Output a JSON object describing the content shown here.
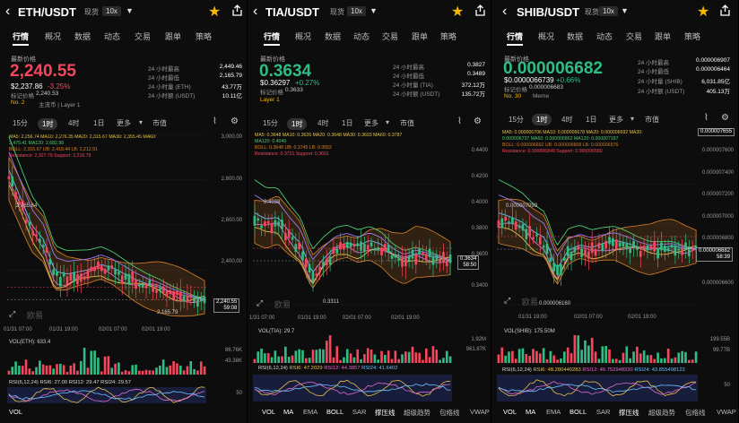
{
  "colors": {
    "up": "#2fbd85",
    "down": "#f6465d",
    "ma5": "#e7c24a",
    "ma10": "#e26bd2",
    "ma20": "#6ac0ff",
    "ma30": "#9b7cf2",
    "ma60": "#f6465d",
    "ma120": "#4ecb73",
    "boll": "#d9822b",
    "accent": "#f5b800"
  },
  "common": {
    "back_icon": "chevron-left-icon",
    "tag": "现货",
    "leverage": "10x",
    "tabs": [
      "行情",
      "概况",
      "数据",
      "动态",
      "交易",
      "跟单",
      "策略"
    ],
    "latest_label": "最新价格",
    "mark_label": "标记价格",
    "stat_labels": [
      "24 小时最高",
      "24 小时最低"
    ],
    "timeframes": [
      "15分",
      "1时",
      "4时",
      "1日"
    ],
    "more": "更多",
    "depth": "市值",
    "watermark": "欧易",
    "bottom": [
      "VOL",
      "MA",
      "EMA",
      "BOLL",
      "SAR",
      "撑压线",
      "超级趋势",
      "包络线",
      "VWAP"
    ]
  },
  "panels": [
    {
      "pair": "ETH/USDT",
      "price": "2,240.55",
      "price_color": "down",
      "usd": "$2,237.86",
      "change": "-3.25%",
      "mark": "2,240.53",
      "rank": "No. 2",
      "tags": "主流币 | Layer 1",
      "stats": [
        [
          "24 小时最高",
          "2,449.46"
        ],
        [
          "24 小时最低",
          "2,165.79"
        ],
        [
          "24 小时量 (ETH)",
          "43.77万"
        ],
        [
          "24 小时额 (USDT)",
          "10.11亿"
        ]
      ],
      "ind1": "MA5: 2,256.74  MA10: 2,276.35  MA20: 2,315.67  MA30: 2,355.45  MA60:",
      "ind2": "2,479.41  MA120: 2,682.96",
      "ind3": "BOLL: 2,315.67  UB: 2,418.44  LB: 2,212.91",
      "ind4": "Resistance: 2,327.79  Support: 2,216.79",
      "axis": [
        "3,000.00",
        "2,800.00",
        "2,600.00",
        "2,400.00",
        "2,200.00"
      ],
      "hi_label": "2,765.64",
      "lo_label": "2,165.79",
      "last": "2,240.55",
      "timer": "59:08",
      "dates": [
        "01/31 07:00",
        "01/31 19:00",
        "02/01 07:00",
        "02/01 19:00"
      ],
      "vol_label": "VOL(ETH): 633.4",
      "vol_axis": [
        "86.76K",
        "43.38K"
      ],
      "rsi": "RSI(6,12,24)  RSI6: 27.00  RSI12: 29.47  RSI24: 29.57",
      "rsi_axis": "50",
      "chart_data": {
        "type": "candlestick",
        "title": "",
        "ylim": [
          2100,
          3050
        ],
        "ticks": [
          3000,
          2800,
          2600,
          2400,
          2200
        ],
        "high": 2765.64,
        "low": 2165.79,
        "last": 2240.55
      }
    },
    {
      "pair": "TIA/USDT",
      "price": "0.3634",
      "price_color": "up",
      "usd": "$0.36297",
      "change": "+0.27%",
      "mark": "0.3633",
      "rank": "",
      "tags": "Layer 1",
      "stats": [
        [
          "24 小时最高",
          "0.3827"
        ],
        [
          "24 小时最低",
          "0.3489"
        ],
        [
          "24 小时量 (TIA)",
          "372.12万"
        ],
        [
          "24 小时额 (USDT)",
          "135.72万"
        ]
      ],
      "ind1": "MA5: 0.3648  MA10: 0.3626  MA20: 0.3648  MA30: 0.3693  MA60: 0.3787",
      "ind2": "MA120: 0.4049",
      "ind3": "BOLL: 0.3648  UB: 0.3745  LB: 0.3552",
      "ind4": "Resistance: 0.3721  Support: 0.3601",
      "axis": [
        "0.4400",
        "0.4200",
        "0.4000",
        "0.3800",
        "0.3600",
        "0.3400"
      ],
      "hi_label": "0.4038",
      "lo_label": "0.3311",
      "last": "0.3634",
      "timer": "58:50",
      "dates": [
        "1/31 07:00",
        "01/31 19:00",
        "02/01 07:00",
        "02/01 19:00"
      ],
      "vol_label": "VOL(TIA): 29.7",
      "vol_axis": [
        "1.92M",
        "961.87K"
      ],
      "rsi": "RSI(6,12,24)  RSI6: 47.2029  RSI12: 44.3857  RSI24: 41.6402",
      "rsi_axis": "",
      "chart_data": {
        "type": "candlestick",
        "title": "",
        "ylim": [
          0.325,
          0.45
        ],
        "ticks": [
          0.44,
          0.42,
          0.4,
          0.38,
          0.36,
          0.34
        ],
        "high": 0.4038,
        "low": 0.3311,
        "last": 0.3634
      }
    },
    {
      "pair": "SHIB/USDT",
      "price": "0.000006682",
      "price_color": "up",
      "usd": "$0.0000066739",
      "change": "+0.66%",
      "mark": "0.000006683",
      "rank": "No. 30",
      "tags": "Meme",
      "stats": [
        [
          "24 小时最高",
          "0.000006907"
        ],
        [
          "24 小时最低",
          "0.000006464"
        ],
        [
          "24 小时量 (SHIB)",
          "6,031.85亿"
        ],
        [
          "24 小时额 (USDT)",
          "405.13万"
        ]
      ],
      "ind1": "MA5: 0.000006706  MA10: 0.000006678  MA20: 0.000006692  MA30:",
      "ind2": "0.000006737  MA60: 0.000006863  MA120: 0.000007187",
      "ind3": "BOLL: 0.000006692  UB: 0.000006808  LB: 0.000006576",
      "ind4": "Resistance: 0.000006840  Support: 0.000006580",
      "axis": [
        "0.000007600",
        "0.000007400",
        "0.000007200",
        "0.000007000",
        "0.000006800",
        "0.000006600"
      ],
      "top_box": "0.000007655",
      "hi_label": "0.000007099",
      "lo_label": "0.000006160",
      "last": "0.000006682",
      "timer": "58:39",
      "dates": [
        "01/31 19:00",
        "02/01 07:00",
        "02/01 19:00"
      ],
      "vol_label": "VOL(SHIB): 175.50M",
      "vol_axis": [
        "199.55B",
        "99.77B"
      ],
      "rsi": "RSI(6,12,24)  RSI6: 48.280440283  RSI12: 46.752948330  RSI24: 43.855498123",
      "rsi_axis": "50",
      "chart_data": {
        "type": "candlestick",
        "title": "",
        "ylim": [
          6.05e-06,
          7.75e-06
        ],
        "ticks": [
          7.6e-06,
          7.4e-06,
          7.2e-06,
          7e-06,
          6.8e-06,
          6.6e-06
        ],
        "high": 7.099e-06,
        "low": 6.16e-06,
        "last": 6.682e-06
      }
    }
  ]
}
